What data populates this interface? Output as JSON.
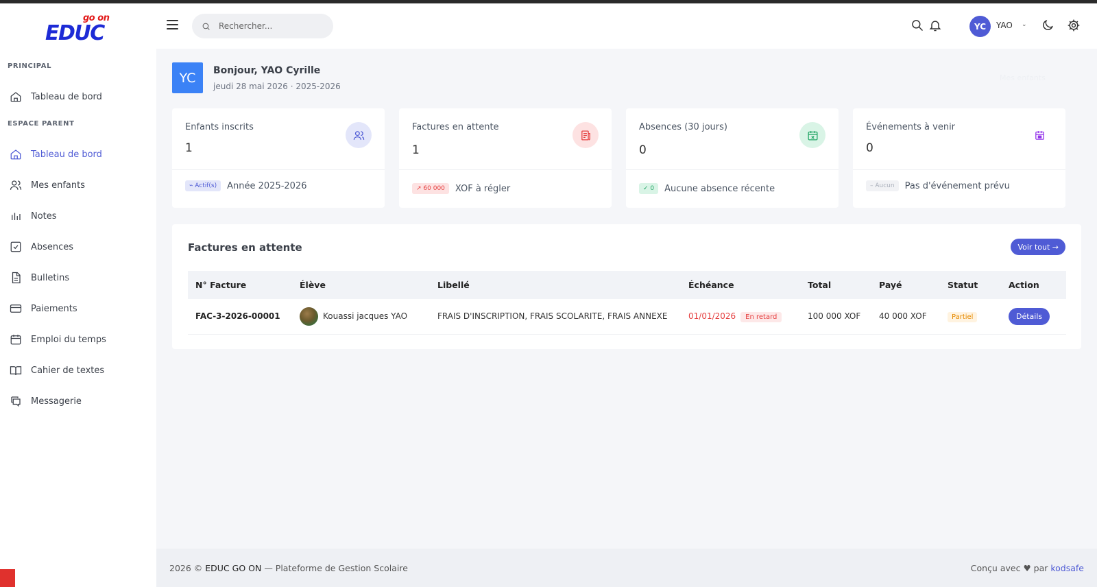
{
  "brand": {
    "logo_sup": "go on",
    "logo_main": "EDUC"
  },
  "sidebar": {
    "section_principal": "PRINCIPAL",
    "section_parent": "ESPACE PARENT",
    "items": [
      {
        "label": "Tableau de bord",
        "icon": "home-icon"
      },
      {
        "label": "Tableau de bord",
        "icon": "home-icon",
        "active": true
      },
      {
        "label": "Mes enfants",
        "icon": "users-icon"
      },
      {
        "label": "Notes",
        "icon": "bar-chart-icon"
      },
      {
        "label": "Absences",
        "icon": "checkbox-icon"
      },
      {
        "label": "Bulletins",
        "icon": "document-icon"
      },
      {
        "label": "Paiements",
        "icon": "credit-card-icon"
      },
      {
        "label": "Emploi du temps",
        "icon": "calendar-icon"
      },
      {
        "label": "Cahier de textes",
        "icon": "book-icon"
      },
      {
        "label": "Messagerie",
        "icon": "chat-icon"
      }
    ]
  },
  "header": {
    "search_placeholder": "Rechercher...",
    "user_initials": "YC",
    "user_name": "YAO"
  },
  "welcome": {
    "initials": "YC",
    "title": "Bonjour, YAO Cyrille",
    "subtitle": "jeudi 28 mai 2026 · 2025-2026",
    "link": "Mes enfants"
  },
  "cards": [
    {
      "title": "Enfants inscrits",
      "value": "1",
      "badge": "Actif(s)",
      "footer": "Année 2025-2026",
      "icon": "users-icon",
      "color": "#4f5bd5"
    },
    {
      "title": "Factures en attente",
      "value": "1",
      "badge": "60 000",
      "footer": "XOF à régler",
      "icon": "invoice-icon",
      "color": "#e53e3e"
    },
    {
      "title": "Absences (30 jours)",
      "value": "0",
      "badge": "0",
      "footer": "Aucune absence récente",
      "icon": "calendar-x-icon",
      "color": "#22a565"
    },
    {
      "title": "Événements à venir",
      "value": "0",
      "badge": "Aucun",
      "footer": "Pas d'événement prévu",
      "icon": "calendar-icon",
      "color": "#9333ea"
    }
  ],
  "invoices": {
    "title": "Factures en attente",
    "view_all": "Voir tout",
    "columns": [
      "N° Facture",
      "Élève",
      "Libellé",
      "Échéance",
      "Total",
      "Payé",
      "Statut",
      "Action"
    ],
    "rows": [
      {
        "number": "FAC-3-2026-00001",
        "student": "Kouassi jacques YAO",
        "label": "FRAIS D'INSCRIPTION, FRAIS SCOLARITE, FRAIS ANNEXE",
        "due": "01/01/2026",
        "due_tag": "En retard",
        "total": "100 000 XOF",
        "paid": "40 000 XOF",
        "status": "Partiel",
        "action": "Détails"
      }
    ]
  },
  "footer": {
    "year": "2026 ©",
    "brand": "EDUC GO ON",
    "tagline": "— Plateforme de Gestion Scolaire",
    "made_with": "Conçu avec",
    "by": "par",
    "author": "kodsafe"
  }
}
